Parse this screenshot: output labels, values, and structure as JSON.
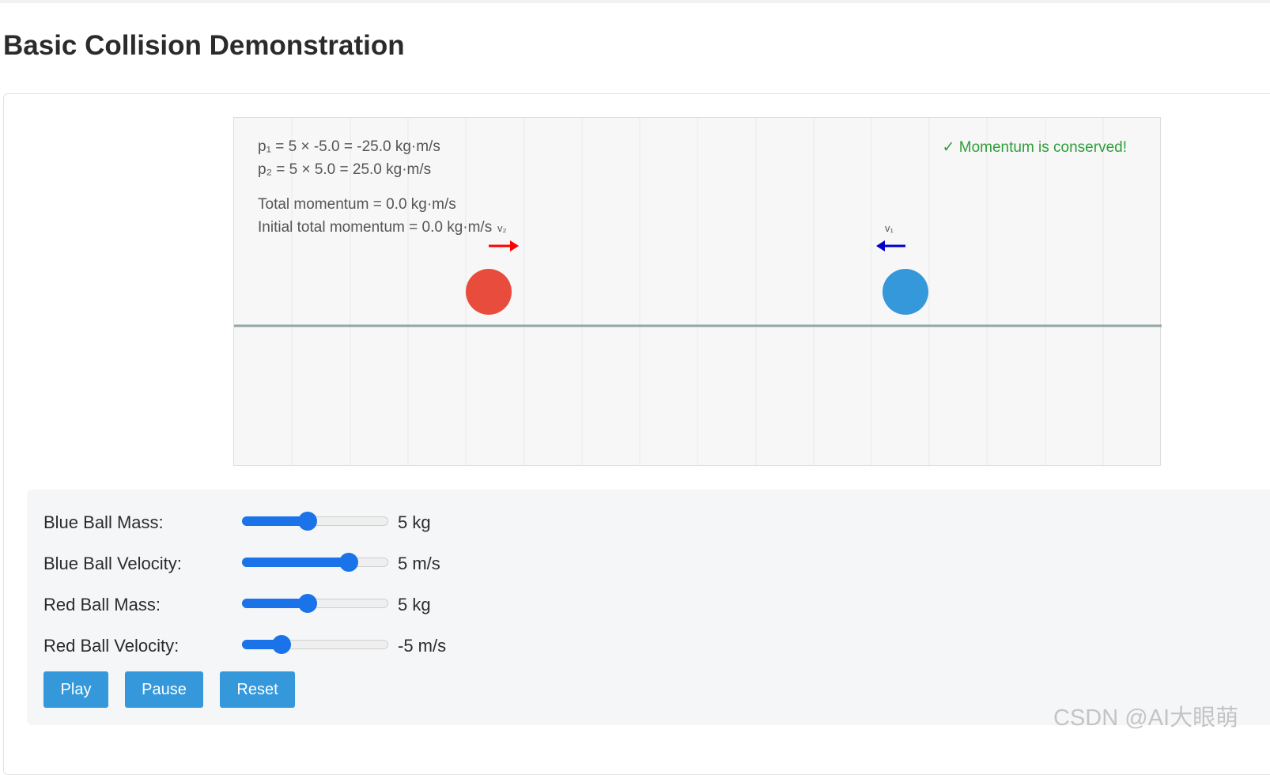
{
  "page": {
    "title": "Basic Collision Demonstration"
  },
  "simulation": {
    "p1_text": "p₁ = 5 × -5.0 = -25.0 kg·m/s",
    "p2_text": "p₂ = 5 × 5.0 = 25.0 kg·m/s",
    "total_text": "Total momentum = 0.0 kg·m/s",
    "initial_text": "Initial total momentum = 0.0 kg·m/s",
    "conserved_text": "✓ Momentum is conserved!",
    "red_velocity_label": "v₂",
    "blue_velocity_label": "v₁",
    "colors": {
      "red_ball": "#e74c3c",
      "blue_ball": "#3498db",
      "red_arrow": "#ff0000",
      "blue_arrow": "#0000cc",
      "ground": "#95a5a6",
      "conserved": "#2e9e3a"
    }
  },
  "controls": {
    "items": [
      {
        "label": "Blue Ball Mass:",
        "value": "5 kg",
        "fraction": 0.45
      },
      {
        "label": "Blue Ball Velocity:",
        "value": "5 m/s",
        "fraction": 0.73
      },
      {
        "label": "Red Ball Mass:",
        "value": "5 kg",
        "fraction": 0.45
      },
      {
        "label": "Red Ball Velocity:",
        "value": "-5 m/s",
        "fraction": 0.27
      }
    ],
    "buttons": {
      "play": "Play",
      "pause": "Pause",
      "reset": "Reset"
    },
    "accent_color": "#1a73e8",
    "button_color": "#3498db"
  },
  "watermark": "CSDN @AI大眼萌"
}
